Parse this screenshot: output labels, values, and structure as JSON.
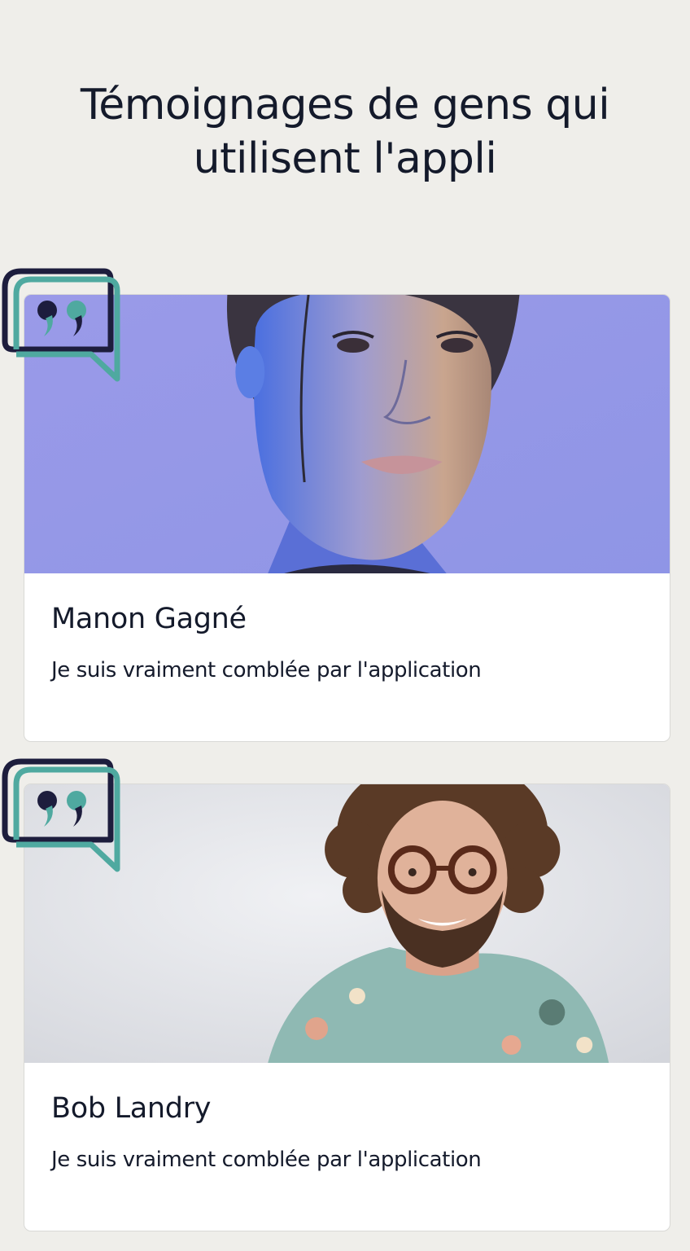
{
  "page": {
    "title_line1": "Témoignages de gens qui",
    "title_line2": "utilisent l'appli"
  },
  "colors": {
    "background": "#efeeea",
    "text": "#141a2b",
    "accent_teal": "#4fa9a0",
    "accent_navy": "#1d1d3d"
  },
  "testimonials": [
    {
      "name": "Manon Gagné",
      "text": "Je suis vraiment comblée par l'application",
      "photo": "woman-portrait-photo",
      "icon": "quote-bubble-icon"
    },
    {
      "name": "Bob Landry",
      "text": "Je suis vraiment comblée par l'application",
      "photo": "man-portrait-photo",
      "icon": "quote-bubble-icon"
    }
  ]
}
